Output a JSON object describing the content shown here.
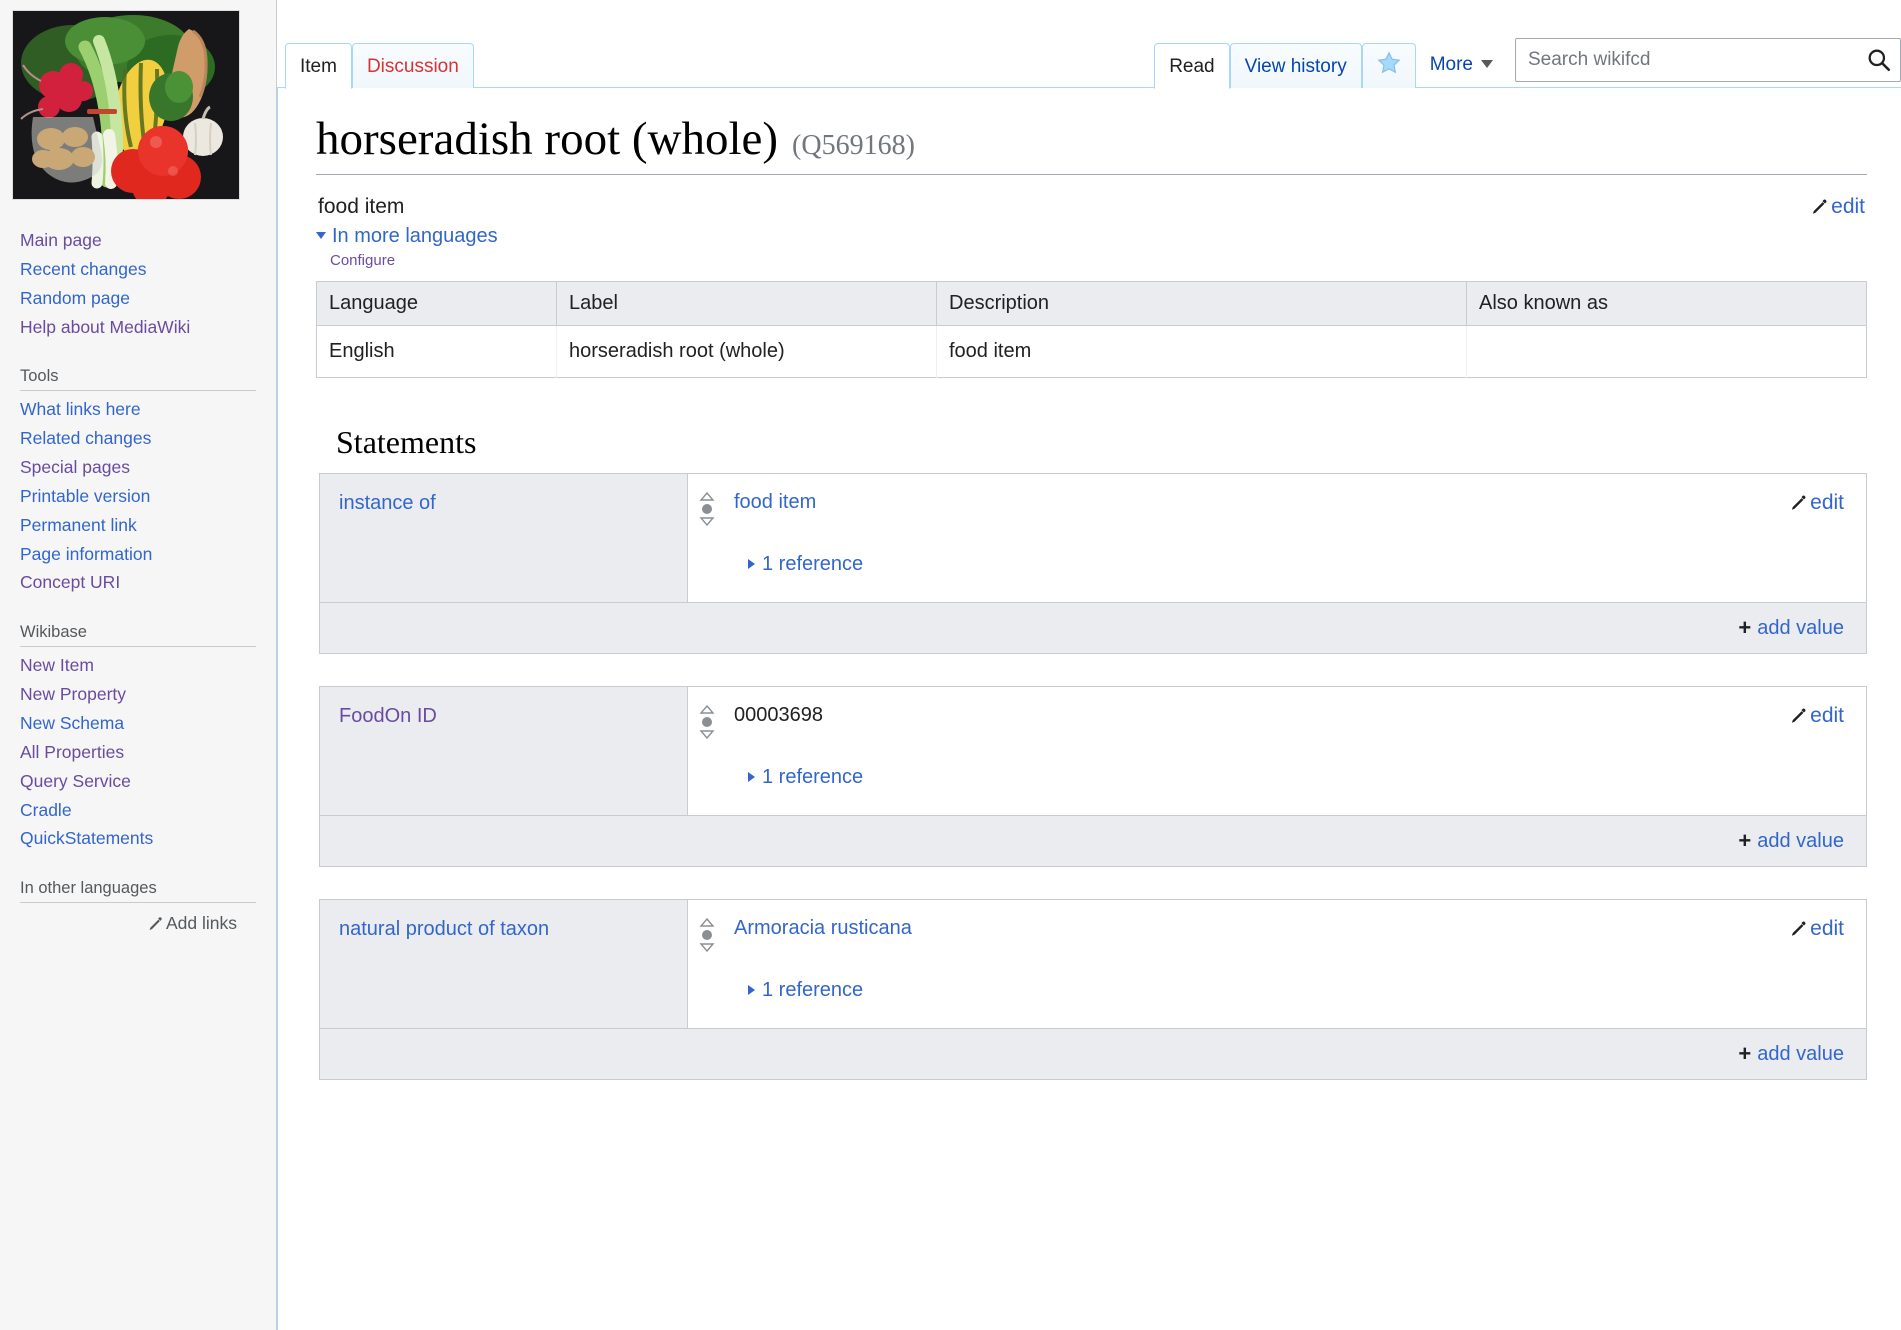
{
  "sidebar": {
    "logo_alt": "assorted vegetables photo",
    "nav_groups": [
      {
        "heading": "",
        "items": [
          {
            "label": "Main page",
            "visited": true
          },
          {
            "label": "Recent changes",
            "visited": false
          },
          {
            "label": "Random page",
            "visited": false
          },
          {
            "label": "Help about MediaWiki",
            "visited": true
          }
        ]
      },
      {
        "heading": "Tools",
        "items": [
          {
            "label": "What links here",
            "visited": false
          },
          {
            "label": "Related changes",
            "visited": false
          },
          {
            "label": "Special pages",
            "visited": true
          },
          {
            "label": "Printable version",
            "visited": false
          },
          {
            "label": "Permanent link",
            "visited": false
          },
          {
            "label": "Page information",
            "visited": false
          },
          {
            "label": "Concept URI",
            "visited": true
          }
        ]
      },
      {
        "heading": "Wikibase",
        "items": [
          {
            "label": "New Item",
            "visited": true
          },
          {
            "label": "New Property",
            "visited": true
          },
          {
            "label": "New Schema",
            "visited": false
          },
          {
            "label": "All Properties",
            "visited": true
          },
          {
            "label": "Query Service",
            "visited": true
          },
          {
            "label": "Cradle",
            "visited": false
          },
          {
            "label": "QuickStatements",
            "visited": false
          }
        ]
      }
    ],
    "other_languages_heading": "In other languages",
    "add_links_label": "Add links"
  },
  "header": {
    "tabs_left": [
      {
        "label": "Item",
        "state": "selected"
      },
      {
        "label": "Discussion",
        "state": "new"
      }
    ],
    "tabs_right": [
      {
        "label": "Read",
        "state": "selected"
      },
      {
        "label": "View history",
        "state": "inactive"
      }
    ],
    "watch_star_icon": "star-icon",
    "more_label": "More"
  },
  "search": {
    "placeholder": "Search wikifcd",
    "value": "",
    "icon": "search-icon"
  },
  "item": {
    "title": "horseradish root (whole)",
    "qid": "(Q569168)",
    "description": "food item",
    "edit_label": "edit"
  },
  "languages_section": {
    "toggle_label": "In more languages",
    "configure_label": "Configure",
    "columns": [
      "Language",
      "Label",
      "Description",
      "Also known as"
    ],
    "rows": [
      {
        "language": "English",
        "label": "horseradish root (whole)",
        "description": "food item",
        "also_known_as": ""
      }
    ]
  },
  "statements_section": {
    "heading": "Statements",
    "edit_label": "edit",
    "reference_label": "1 reference",
    "add_value_label": "add value",
    "rank_icon": "rank-normal-icon",
    "statements": [
      {
        "property": "instance of",
        "property_visited": false,
        "value": "food item",
        "value_is_link": true
      },
      {
        "property": "FoodOn ID",
        "property_visited": true,
        "value": "00003698",
        "value_is_link": false
      },
      {
        "property": "natural product of taxon",
        "property_visited": false,
        "value": "Armoracia rusticana",
        "value_is_link": true
      }
    ]
  }
}
